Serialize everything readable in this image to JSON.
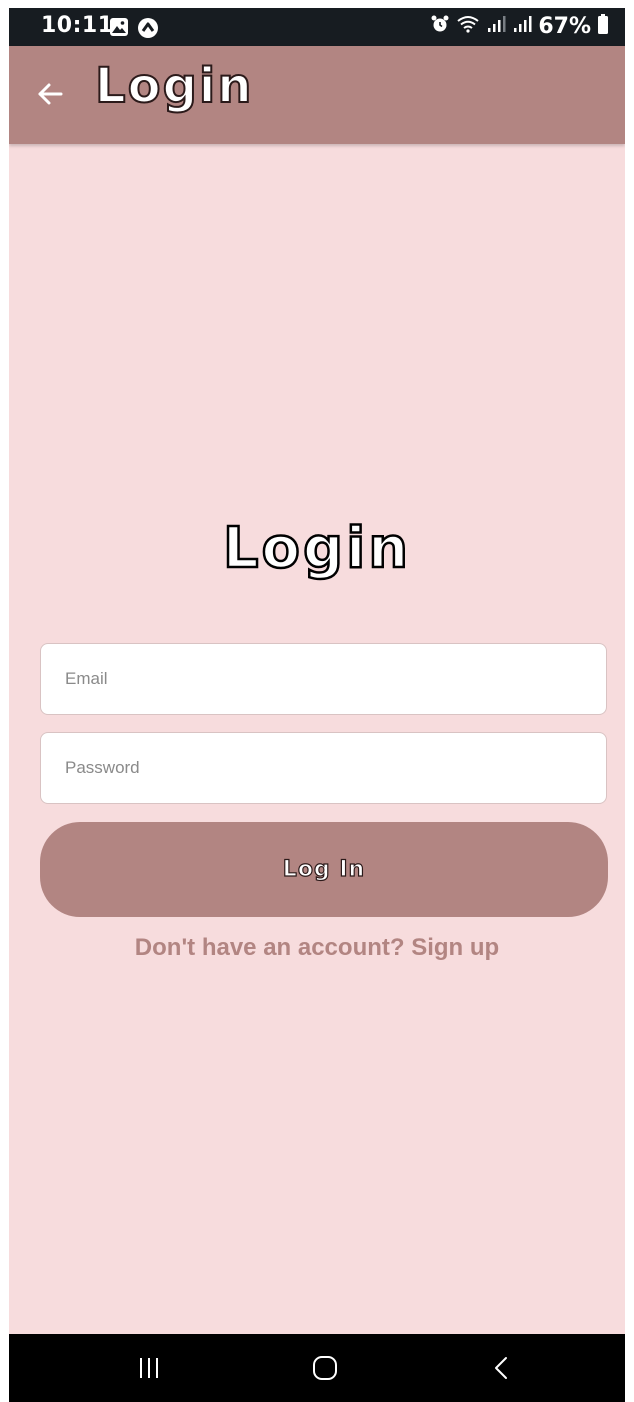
{
  "status_bar": {
    "time": "10:11",
    "battery": "67%",
    "left_icons": [
      "gallery-icon",
      "app-notification-icon"
    ],
    "right_icons": [
      "alarm-icon",
      "wifi-icon",
      "signal-icon",
      "signal-icon",
      "battery-icon"
    ]
  },
  "app_bar": {
    "title": "Login",
    "back_icon": "arrow-left-icon"
  },
  "main": {
    "title": "Login",
    "email_placeholder": "Email",
    "password_placeholder": "Password",
    "login_button_label": "Log In",
    "signup_text": "Don't have an account? Sign up"
  },
  "nav_bar": {
    "icons": [
      "recent-apps-icon",
      "home-icon",
      "back-icon"
    ]
  },
  "colors": {
    "accent": "#b28582",
    "background": "#f7dcdd",
    "status_bar": "#171c21",
    "nav_bar": "#000000"
  }
}
